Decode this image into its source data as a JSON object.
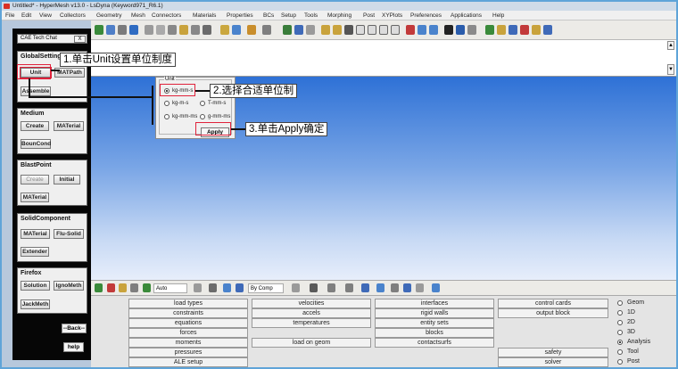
{
  "window": {
    "title": "Untitled* - HyperMesh v13.0 - LsDyna (Keyword971_R6.1)"
  },
  "menubar": [
    "File",
    "Edit",
    "View",
    "Collectors",
    "Geometry",
    "Mesh",
    "Connectors",
    "Materials",
    "Properties",
    "BCs",
    "Setup",
    "Tools",
    "Morphing",
    "Post",
    "XYPlots",
    "Preferences",
    "Applications",
    "Help"
  ],
  "sidebar": {
    "title": "CAE Tech Chat",
    "close_label": "X",
    "global": {
      "header": "GlobalSetting",
      "unit": "Unit",
      "matpath": "MATPath",
      "assemble": "Assemble"
    },
    "medium": {
      "header": "Medium",
      "create": "Create",
      "material": "MATerial",
      "boundcond": "BounCond"
    },
    "blastpoint": {
      "header": "BlastPoint",
      "create": "Create",
      "initial": "Initial",
      "material": "MATerial"
    },
    "solid": {
      "header": "SolidComponent",
      "material": "MATerial",
      "flusolid": "Flu-Solid",
      "extender": "Extender"
    },
    "firefox": {
      "header": "Firefox",
      "solution": "Solution",
      "ignometh": "IgnoMeth",
      "jackmeth": "JackMeth"
    },
    "back": "--Back--",
    "help": "help"
  },
  "unit_dialog": {
    "group": "Unit",
    "options": [
      "kg-mm-s",
      "kg-m-s",
      "T-mm-s",
      "kg-mm-ms",
      "g-mm-ms"
    ],
    "selected": "kg-mm-s",
    "apply": "Apply"
  },
  "callouts": [
    "1.单击Unit设置单位制度",
    "2.选择合适单位制",
    "3.单击Apply确定"
  ],
  "toolbar2": {
    "auto": "Auto",
    "bycomp": "By Comp"
  },
  "panel": {
    "col1": [
      "load types",
      "constraints",
      "equations",
      "forces",
      "moments",
      "pressures",
      "ALE setup"
    ],
    "col2": [
      "velocities",
      "accels",
      "temperatures",
      "load on geom"
    ],
    "col3": [
      "interfaces",
      "rigid walls",
      "entity sets",
      "blocks",
      "contactsurfs"
    ],
    "col4": [
      "control cards",
      "output block",
      "safety",
      "solver"
    ],
    "radios": [
      "Geom",
      "1D",
      "2D",
      "3D",
      "Analysis",
      "Tool",
      "Post"
    ],
    "selected_radio": "Analysis"
  },
  "colors": {
    "highlight": "#e0223b",
    "graphics_top": "#2e71d6",
    "graphics_bottom": "#e7eefb"
  }
}
